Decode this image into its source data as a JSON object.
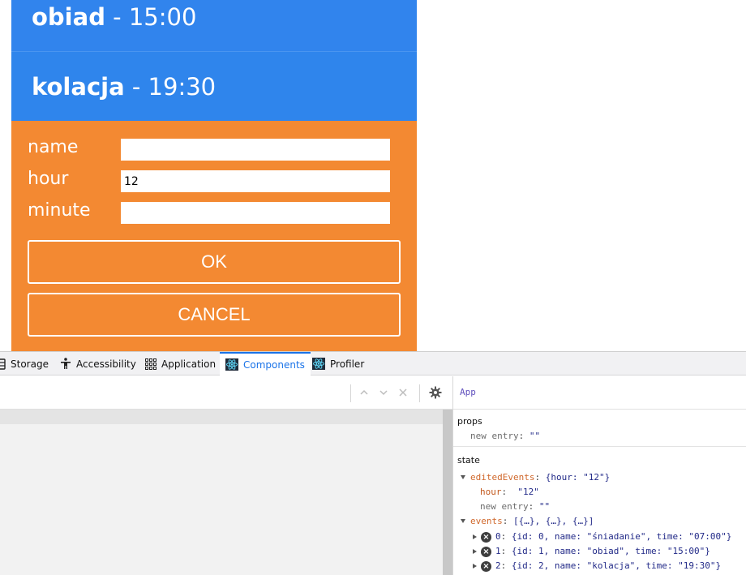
{
  "app": {
    "events": [
      {
        "name": "obiad",
        "sep": " - ",
        "time": "15:00"
      },
      {
        "name": "kolacja",
        "sep": " - ",
        "time": "19:30"
      }
    ],
    "form": {
      "fields": [
        {
          "label": "name",
          "value": ""
        },
        {
          "label": "hour",
          "value": "12"
        },
        {
          "label": "minute",
          "value": ""
        }
      ],
      "ok_label": "OK",
      "cancel_label": "CANCEL"
    },
    "colors": {
      "event_bg": "#2d86ee",
      "form_bg": "#f38932"
    }
  },
  "devtools": {
    "tabs": [
      {
        "label": "Storage",
        "icon": "storage-icon"
      },
      {
        "label": "Accessibility",
        "icon": "accessibility-icon"
      },
      {
        "label": "Application",
        "icon": "grid-icon"
      },
      {
        "label": "Components",
        "icon": "react-icon",
        "active": true
      },
      {
        "label": "Profiler",
        "icon": "react-icon"
      }
    ],
    "selected_component": "App",
    "props_title": "props",
    "props": [
      {
        "key": "new entry",
        "value": "\"\""
      }
    ],
    "state_title": "state",
    "state": {
      "edited_key": "editedEvents",
      "edited_summary": "{hour: \"12\"}",
      "edited_children": [
        {
          "key": "hour",
          "value": "\"12\""
        },
        {
          "key": "new entry",
          "value": "\"\""
        }
      ],
      "events_key": "events",
      "events_summary": "[{…}, {…}, {…}]",
      "events_items": [
        {
          "index": "0",
          "value": "{id: 0, name: \"śniadanie\", time: \"07:00\"}"
        },
        {
          "index": "1",
          "value": "{id: 1, name: \"obiad\", time: \"15:00\"}"
        },
        {
          "index": "2",
          "value": "{id: 2, name: \"kolacja\", time: \"19:30\"}"
        }
      ]
    }
  }
}
